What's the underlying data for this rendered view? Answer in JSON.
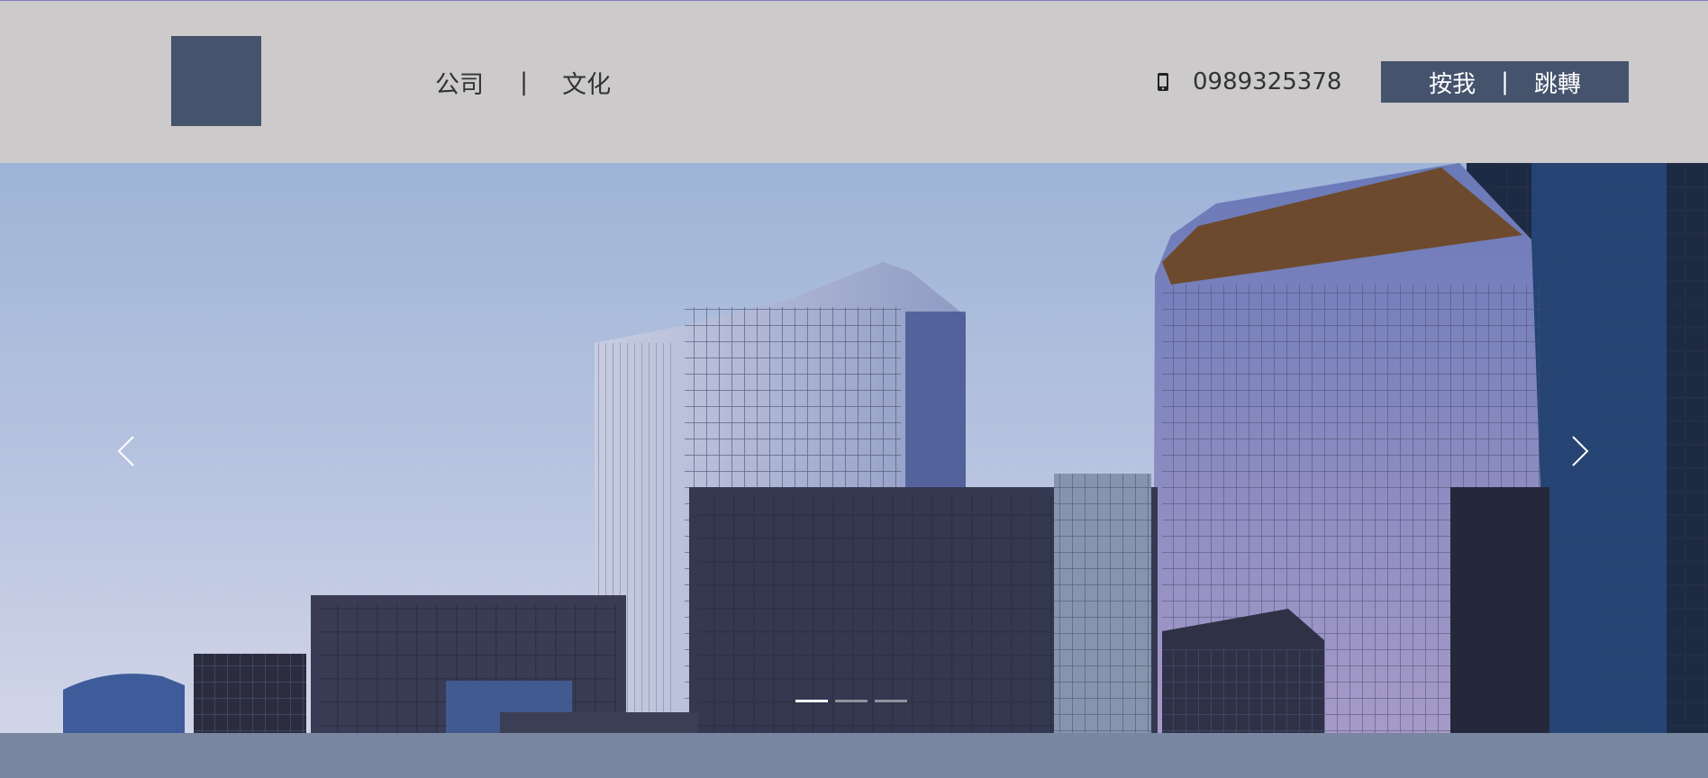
{
  "header": {
    "nav": [
      {
        "label": "公司"
      },
      {
        "label": "文化"
      }
    ],
    "nav_separator": "|",
    "phone": "0989325378",
    "cta": {
      "left": "按我",
      "separator": "|",
      "right": "跳轉"
    }
  },
  "hero": {
    "slide_count": 3,
    "active_slide": 1
  },
  "colors": {
    "header_bg": "#cdcacb",
    "brand": "#45536d",
    "footer_band": "#78869f"
  },
  "icons": [
    "mobile-phone-icon",
    "chevron-left-icon",
    "chevron-right-icon"
  ]
}
